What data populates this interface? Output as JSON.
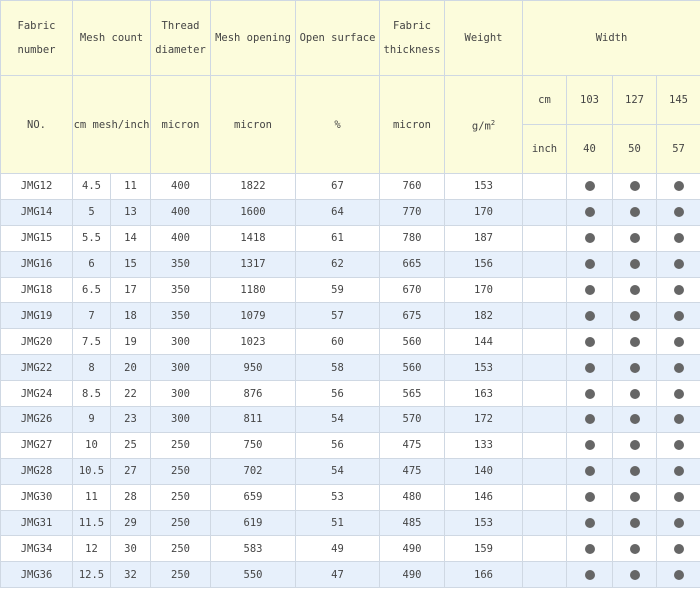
{
  "headers": {
    "fabric_number": "Fabric number",
    "mesh_count": "Mesh count",
    "thread_diameter": "Thread diameter",
    "mesh_opening": "Mesh opening",
    "open_surface": "Open surface",
    "fabric_thickness": "Fabric thickness",
    "weight": "Weight",
    "width": "Width"
  },
  "units": {
    "fabric_number": "NO.",
    "mesh_count": "cm mesh/inch",
    "thread_diameter": "micron",
    "mesh_opening": "micron",
    "open_surface": "%",
    "fabric_thickness": "micron",
    "weight_base": "g/m",
    "weight_exp": "2"
  },
  "width_units": {
    "cm": {
      "label": "cm",
      "values": [
        "103",
        "127",
        "145"
      ]
    },
    "inch": {
      "label": "inch",
      "values": [
        "40",
        "50",
        "57"
      ]
    }
  },
  "rows": [
    {
      "no": "JMG12",
      "mesh_cm": "4.5",
      "mesh_inch": "11",
      "thread": "400",
      "opening": "1822",
      "open": "67",
      "thickness": "760",
      "weight": "153"
    },
    {
      "no": "JMG14",
      "mesh_cm": "5",
      "mesh_inch": "13",
      "thread": "400",
      "opening": "1600",
      "open": "64",
      "thickness": "770",
      "weight": "170"
    },
    {
      "no": "JMG15",
      "mesh_cm": "5.5",
      "mesh_inch": "14",
      "thread": "400",
      "opening": "1418",
      "open": "61",
      "thickness": "780",
      "weight": "187"
    },
    {
      "no": "JMG16",
      "mesh_cm": "6",
      "mesh_inch": "15",
      "thread": "350",
      "opening": "1317",
      "open": "62",
      "thickness": "665",
      "weight": "156"
    },
    {
      "no": "JMG18",
      "mesh_cm": "6.5",
      "mesh_inch": "17",
      "thread": "350",
      "opening": "1180",
      "open": "59",
      "thickness": "670",
      "weight": "170"
    },
    {
      "no": "JMG19",
      "mesh_cm": "7",
      "mesh_inch": "18",
      "thread": "350",
      "opening": "1079",
      "open": "57",
      "thickness": "675",
      "weight": "182"
    },
    {
      "no": "JMG20",
      "mesh_cm": "7.5",
      "mesh_inch": "19",
      "thread": "300",
      "opening": "1023",
      "open": "60",
      "thickness": "560",
      "weight": "144"
    },
    {
      "no": "JMG22",
      "mesh_cm": "8",
      "mesh_inch": "20",
      "thread": "300",
      "opening": "950",
      "open": "58",
      "thickness": "560",
      "weight": "153"
    },
    {
      "no": "JMG24",
      "mesh_cm": "8.5",
      "mesh_inch": "22",
      "thread": "300",
      "opening": "876",
      "open": "56",
      "thickness": "565",
      "weight": "163"
    },
    {
      "no": "JMG26",
      "mesh_cm": "9",
      "mesh_inch": "23",
      "thread": "300",
      "opening": "811",
      "open": "54",
      "thickness": "570",
      "weight": "172"
    },
    {
      "no": "JMG27",
      "mesh_cm": "10",
      "mesh_inch": "25",
      "thread": "250",
      "opening": "750",
      "open": "56",
      "thickness": "475",
      "weight": "133"
    },
    {
      "no": "JMG28",
      "mesh_cm": "10.5",
      "mesh_inch": "27",
      "thread": "250",
      "opening": "702",
      "open": "54",
      "thickness": "475",
      "weight": "140"
    },
    {
      "no": "JMG30",
      "mesh_cm": "11",
      "mesh_inch": "28",
      "thread": "250",
      "opening": "659",
      "open": "53",
      "thickness": "480",
      "weight": "146"
    },
    {
      "no": "JMG31",
      "mesh_cm": "11.5",
      "mesh_inch": "29",
      "thread": "250",
      "opening": "619",
      "open": "51",
      "thickness": "485",
      "weight": "153"
    },
    {
      "no": "JMG34",
      "mesh_cm": "12",
      "mesh_inch": "30",
      "thread": "250",
      "opening": "583",
      "open": "49",
      "thickness": "490",
      "weight": "159"
    },
    {
      "no": "JMG36",
      "mesh_cm": "12.5",
      "mesh_inch": "32",
      "thread": "250",
      "opening": "550",
      "open": "47",
      "thickness": "490",
      "weight": "166"
    }
  ],
  "availability_icon": "filled-circle-icon",
  "colors": {
    "header_bg": "#fcfcdc",
    "row_alt_bg": "#e7f0fb",
    "border": "#cfd8e3",
    "text": "#444444",
    "dot": "#666666"
  }
}
